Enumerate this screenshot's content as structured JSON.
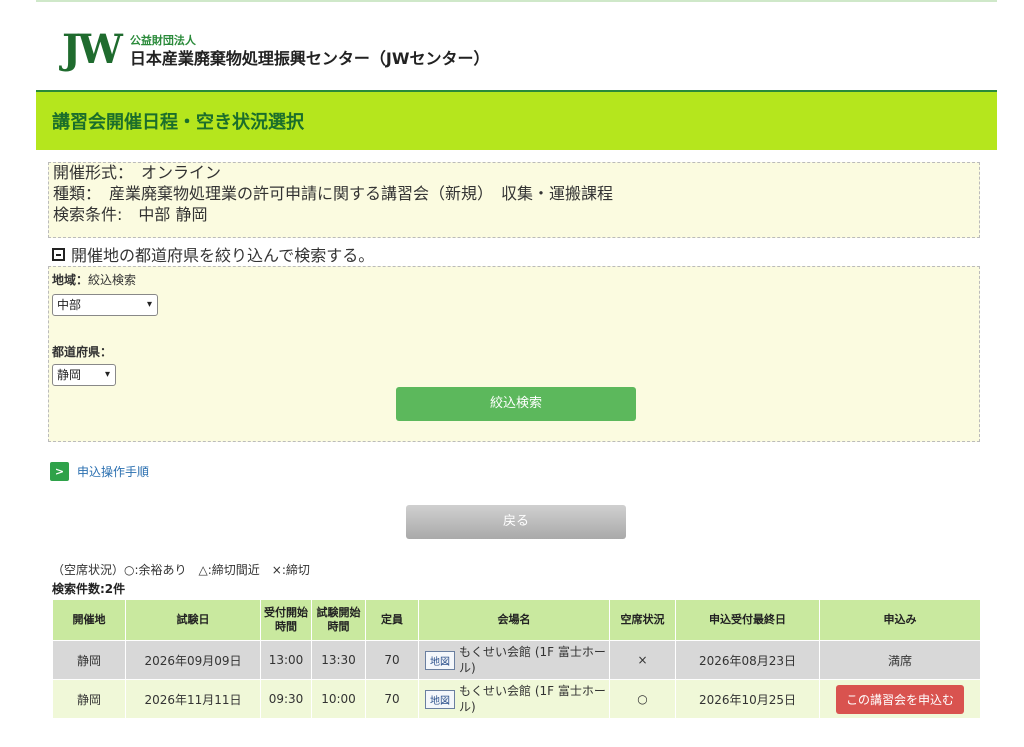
{
  "logo": {
    "mark": "JW",
    "sub": "公益財団法人",
    "main": "日本産業廃棄物処理振興センター（JWセンター）"
  },
  "page_title": "講習会開催日程・空き状況選択",
  "info": {
    "format": "開催形式：　オンライン",
    "type": "種類：　産業廃棄物処理業の許可申請に関する講習会（新規）　収集・運搬課程",
    "conditions": "検索条件:　中部 静岡"
  },
  "filter": {
    "toggle_label": "開催地の都道府県を絞り込んで検索する。",
    "region_label": "地域：",
    "region_sub": "絞込検索",
    "region_value": "中部",
    "pref_label": "都道府県：",
    "pref_value": "静岡",
    "search_button": "絞込検索"
  },
  "procedure_link": "申込操作手順",
  "back_button": "戻る",
  "legend": "（空席状況）○:余裕あり　△:締切間近　×:締切",
  "result_count": "検索件数:2件",
  "table": {
    "headers": {
      "place": "開催地",
      "exam_date": "試験日",
      "reception_start": "受付開始時間",
      "exam_start": "試験開始時間",
      "capacity": "定員",
      "venue": "会場名",
      "vacancy": "空席状況",
      "deadline": "申込受付最終日",
      "apply": "申込み"
    },
    "rows": [
      {
        "place": "静岡",
        "exam_date": "2026年09月09日",
        "reception_start": "13:00",
        "exam_start": "13:30",
        "capacity": "70",
        "map": "地図",
        "venue": "もくせい会館 (1F 富士ホール)",
        "vacancy": "×",
        "deadline": "2026年08月23日",
        "apply": "満席"
      },
      {
        "place": "静岡",
        "exam_date": "2026年11月11日",
        "reception_start": "09:30",
        "exam_start": "10:00",
        "capacity": "70",
        "map": "地図",
        "venue": "もくせい会館 (1F 富士ホール)",
        "vacancy": "○",
        "deadline": "2026年10月25日",
        "apply": "この講習会を申込む"
      }
    ]
  },
  "colors": {
    "header_green": "#b5e61d",
    "title_green": "#1b6e2b",
    "button_green": "#5cb85c",
    "apply_red": "#d9534f",
    "table_header": "#c9e99f"
  }
}
